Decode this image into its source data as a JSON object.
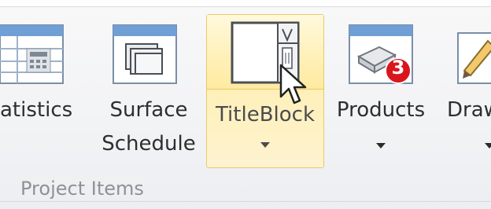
{
  "group": {
    "label": "Project Items"
  },
  "buttons": [
    {
      "label": "atistics",
      "icon": "statistics-spreadsheet-icon",
      "has_dropdown": false
    },
    {
      "label_line1": "Surface",
      "label_line2": "Schedule",
      "icon": "surface-schedule-icon",
      "has_dropdown": false
    },
    {
      "label": "TitleBlock",
      "icon": "titleblock-icon",
      "has_dropdown": true,
      "state": "hover"
    },
    {
      "label": "Products",
      "icon": "products-icon",
      "badge": "3",
      "has_dropdown": true
    },
    {
      "label": "Draw",
      "icon": "drawing-pencil-icon",
      "has_dropdown": true
    }
  ],
  "colors": {
    "hover_bg_top": "#fff6d0",
    "hover_border": "#e8c96a",
    "badge": "#d9161c",
    "icon_blue": "#6f9fd4"
  }
}
